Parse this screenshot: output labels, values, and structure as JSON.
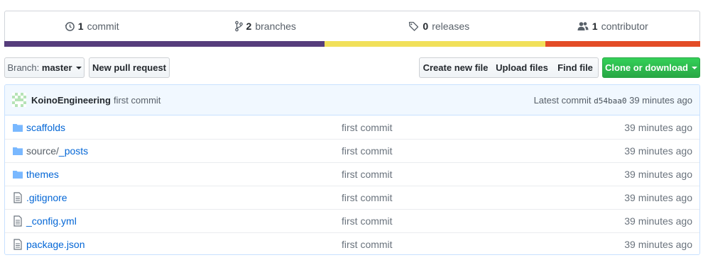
{
  "summary": {
    "commits": {
      "count": "1",
      "label": "commit",
      "icon": "history-icon"
    },
    "branches": {
      "count": "2",
      "label": "branches",
      "icon": "git-branch-icon"
    },
    "releases": {
      "count": "0",
      "label": "releases",
      "icon": "tag-icon"
    },
    "contributors": {
      "count": "1",
      "label": "contributor",
      "icon": "people-icon"
    },
    "language_colors": [
      "#563d7c",
      "#f1e05a",
      "#e34c26"
    ],
    "language_shares": [
      0.46,
      0.318,
      0.222
    ]
  },
  "toolbar": {
    "branch_prefix": "Branch:",
    "branch_name": "master",
    "new_pull_request": "New pull request",
    "create_new_file": "Create new file",
    "upload_files": "Upload files",
    "find_file": "Find file",
    "clone_or_download": "Clone or download"
  },
  "latest_commit": {
    "author": "KoinoEngineering",
    "message": "first commit",
    "label": "Latest commit",
    "sha": "d54baa0",
    "age": "39 minutes ago"
  },
  "files": [
    {
      "type": "dir",
      "name": "scaffolds",
      "message": "first commit",
      "age": "39 minutes ago"
    },
    {
      "type": "dir",
      "name_prefix": "source/",
      "name": "_posts",
      "message": "first commit",
      "age": "39 minutes ago"
    },
    {
      "type": "dir",
      "name": "themes",
      "message": "first commit",
      "age": "39 minutes ago"
    },
    {
      "type": "file",
      "name": ".gitignore",
      "message": "first commit",
      "age": "39 minutes ago"
    },
    {
      "type": "file",
      "name": "_config.yml",
      "message": "first commit",
      "age": "39 minutes ago"
    },
    {
      "type": "file",
      "name": "package.json",
      "message": "first commit",
      "age": "39 minutes ago"
    }
  ],
  "colors": {
    "link": "#0366d6",
    "muted": "#586069",
    "green_button": "#28a745",
    "commit_tease_bg": "#f1f8ff",
    "folder_icon": "#79b8ff"
  }
}
